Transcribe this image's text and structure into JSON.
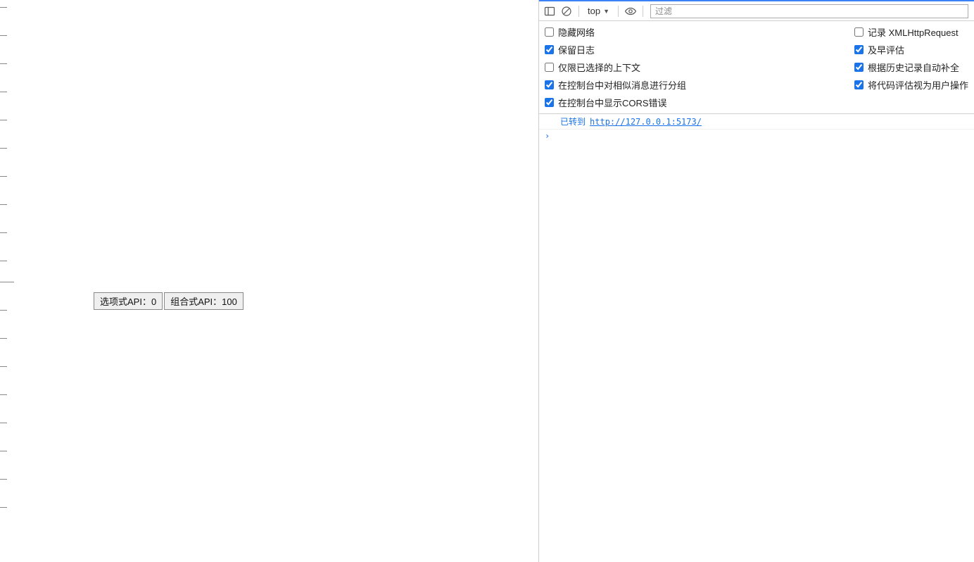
{
  "page": {
    "buttons": {
      "options_api": "选项式API：0",
      "composition_api": "组合式API：100"
    }
  },
  "toolbar": {
    "context": "top",
    "filter_placeholder": "过滤"
  },
  "settings": {
    "hide_network": {
      "label": "隐藏网络",
      "checked": false
    },
    "log_xhr": {
      "label": "记录 XMLHttpRequest",
      "checked": false
    },
    "preserve_log": {
      "label": "保留日志",
      "checked": true
    },
    "eager_eval": {
      "label": "及早评估",
      "checked": true
    },
    "selected_context_only": {
      "label": "仅限已选择的上下文",
      "checked": false
    },
    "autocomplete_history": {
      "label": "根据历史记录自动补全",
      "checked": true
    },
    "group_similar": {
      "label": "在控制台中对相似消息进行分组",
      "checked": true
    },
    "eval_as_user_action": {
      "label": "将代码评估视为用户操作",
      "checked": true
    },
    "show_cors": {
      "label": "在控制台中显示CORS错误",
      "checked": true
    }
  },
  "console": {
    "navigated_label": "已转到",
    "navigated_url": "http://127.0.0.1:5173/"
  }
}
